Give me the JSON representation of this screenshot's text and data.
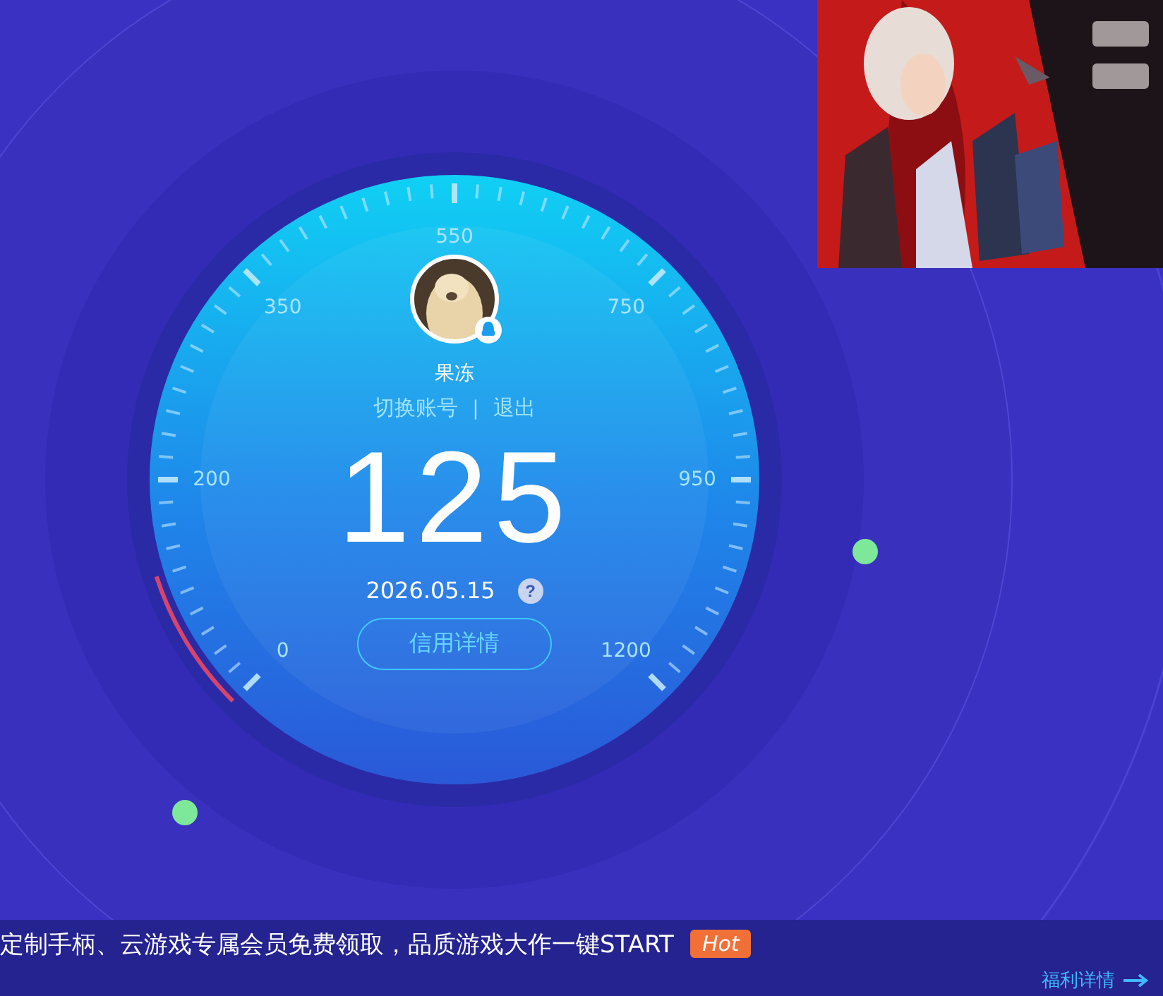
{
  "gauge": {
    "scale_labels": [
      "0",
      "200",
      "350",
      "550",
      "750",
      "950",
      "1200"
    ],
    "level": 0.1
  },
  "user": {
    "name": "果冻",
    "switch_account": "切换账号",
    "separator": "|",
    "logout": "退出"
  },
  "score": "125",
  "date": "2026.05.15",
  "help_icon": "?",
  "details_button": "信用详情",
  "banner": {
    "title": "定制手柄、云游戏专属会员免费领取，品质游戏大作一键START",
    "tag": "Hot",
    "link": "福利详情"
  }
}
